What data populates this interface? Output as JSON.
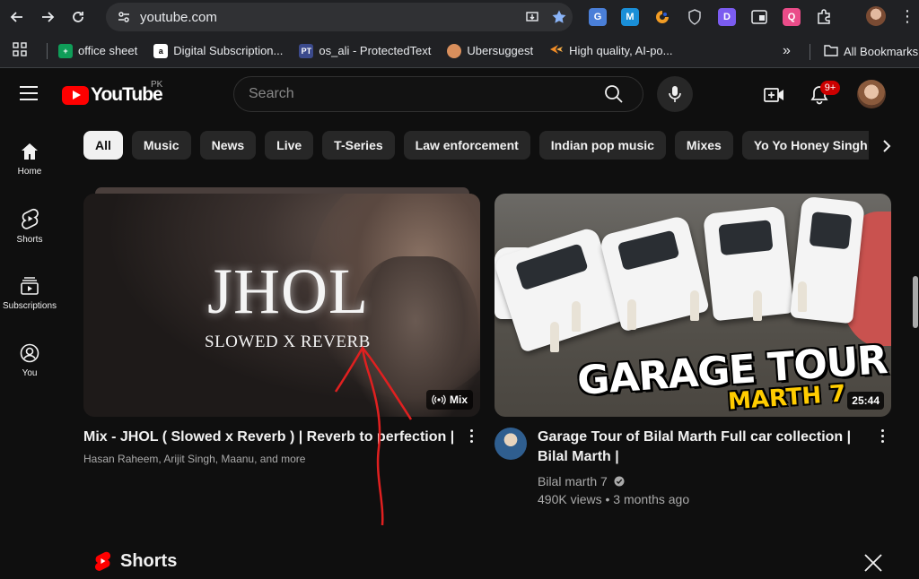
{
  "browser": {
    "url": "youtube.com",
    "bookmarks": [
      {
        "label": "office sheet",
        "icon": "sheets-icon",
        "color": "#0f9d58"
      },
      {
        "label": "Digital Subscription...",
        "icon": "amazon-icon",
        "color": "#ffffff"
      },
      {
        "label": "os_ali - ProtectedText",
        "icon": "protectedtext-icon",
        "color": "#3b4a8c"
      },
      {
        "label": "Ubersuggest",
        "icon": "ubersuggest-icon",
        "color": "#d98f5c"
      },
      {
        "label": "High quality, AI-po...",
        "icon": "star-orange-icon",
        "color": "#f28b24"
      }
    ],
    "overflow": "»",
    "all_bookmarks": "All Bookmarks"
  },
  "header": {
    "logo_text": "YouTube",
    "country_code": "PK",
    "search_placeholder": "Search",
    "notification_count": "9+"
  },
  "chips": [
    "All",
    "Music",
    "News",
    "Live",
    "T-Series",
    "Law enforcement",
    "Indian pop music",
    "Mixes",
    "Yo Yo Honey Singh"
  ],
  "guide": [
    {
      "label": "Home",
      "icon": "home-icon"
    },
    {
      "label": "Shorts",
      "icon": "shorts-icon"
    },
    {
      "label": "Subscriptions",
      "icon": "subscriptions-icon"
    },
    {
      "label": "You",
      "icon": "you-icon"
    }
  ],
  "videos": [
    {
      "thumb_title": "JHOL",
      "thumb_subtitle": "SLOWED X REVERB",
      "badge": "Mix",
      "title": "Mix - JHOL ( Slowed x Reverb ) | Reverb to perfection |",
      "subtitle": "Hasan Raheem, Arijit Singh, Maanu, and more"
    },
    {
      "thumb_title": "GARAGE TOUR",
      "thumb_subtitle": "MARTH 7",
      "duration": "25:44",
      "title": "Garage Tour of Bilal Marth Full car collection | Bilal Marth |",
      "channel": "Bilal marth 7",
      "stats": "490K views • 3 months ago"
    }
  ],
  "shorts": {
    "title": "Shorts"
  },
  "colors": {
    "accent": "#ff0000",
    "annotation": "#e02020",
    "background": "#0f0f0f"
  }
}
